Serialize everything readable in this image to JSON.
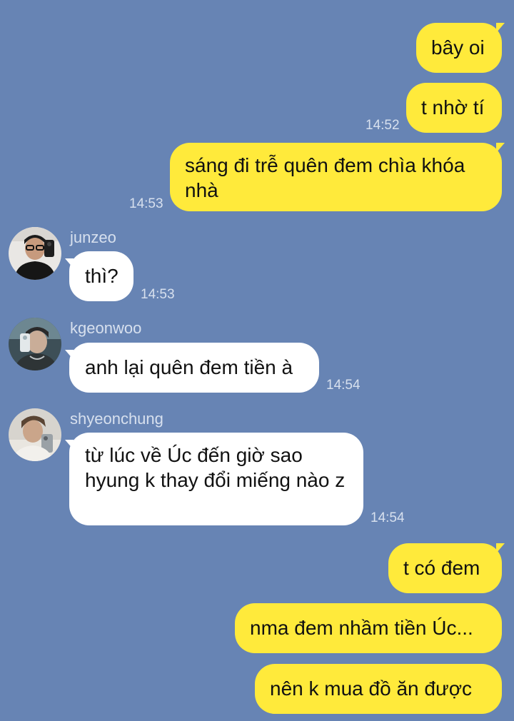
{
  "messages": [
    {
      "side": "me",
      "text": "bây oi"
    },
    {
      "side": "me",
      "text": "t nhờ tí",
      "time": "14:52"
    },
    {
      "side": "me",
      "text": "sáng đi trễ quên đem chìa khóa nhà",
      "time": "14:53"
    },
    {
      "side": "them",
      "sender": "junzeo",
      "text": "thì?",
      "time": "14:53"
    },
    {
      "side": "them",
      "sender": "kgeonwoo",
      "text": "anh lại quên đem tiền à",
      "time": "14:54"
    },
    {
      "side": "them",
      "sender": "shyeonchung",
      "text": "từ lúc về Úc đến giờ sao hyung k thay đổi miếng nào z",
      "time": "14:54"
    },
    {
      "side": "me",
      "text": "t có đem"
    },
    {
      "side": "me",
      "text": "nma đem nhầm tiền Úc..."
    },
    {
      "side": "me",
      "text": "nên k mua đồ ăn được"
    }
  ],
  "colors": {
    "background": "#6784b4",
    "my_bubble": "#ffea3b",
    "their_bubble": "#ffffff",
    "meta_text": "#d7e0ee"
  }
}
